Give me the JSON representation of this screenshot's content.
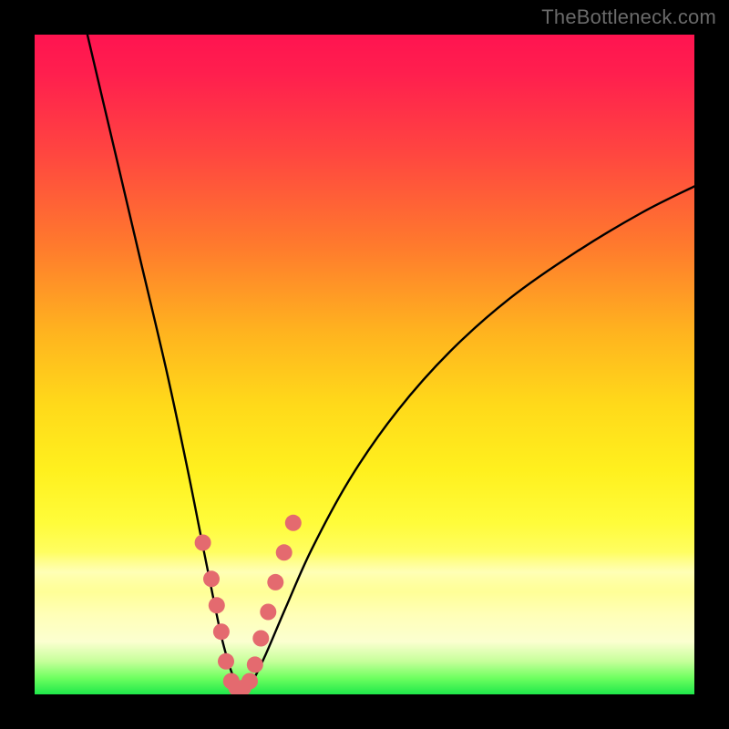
{
  "watermark": "TheBottleneck.com",
  "chart_data": {
    "type": "line",
    "title": "",
    "xlabel": "",
    "ylabel": "",
    "xlim": [
      0,
      100
    ],
    "ylim": [
      0,
      100
    ],
    "grid": false,
    "legend": false,
    "series": [
      {
        "name": "bottleneck-curve",
        "x": [
          8,
          12,
          16,
          20,
          23,
          25,
          27,
          28.5,
          30,
          31.5,
          33,
          35,
          38,
          42,
          48,
          55,
          63,
          72,
          82,
          92,
          100
        ],
        "values": [
          100,
          83,
          66,
          49,
          35,
          25,
          15,
          8,
          3,
          1,
          2,
          6,
          13,
          22,
          33,
          43,
          52,
          60,
          67,
          73,
          77
        ]
      }
    ],
    "markers": [
      {
        "name": "highlight-dots",
        "color": "#e46a6f",
        "radius_px": 9,
        "x": [
          25.5,
          26.8,
          27.6,
          28.3,
          29.0,
          29.8,
          30.6,
          31.6,
          32.6,
          33.4,
          34.3,
          35.4,
          36.5,
          37.8,
          39.2
        ],
        "values": [
          23.0,
          17.5,
          13.5,
          9.5,
          5.0,
          2.0,
          1.0,
          1.0,
          2.0,
          4.5,
          8.5,
          12.5,
          17.0,
          21.5,
          26.0
        ]
      }
    ],
    "background_gradient": {
      "direction": "vertical",
      "stops": [
        {
          "pos": 0.0,
          "color": "#ff1450"
        },
        {
          "pos": 0.32,
          "color": "#ff7a2d"
        },
        {
          "pos": 0.56,
          "color": "#ffd91a"
        },
        {
          "pos": 0.88,
          "color": "#ffffb8"
        },
        {
          "pos": 1.0,
          "color": "#1fe84a"
        }
      ]
    }
  }
}
